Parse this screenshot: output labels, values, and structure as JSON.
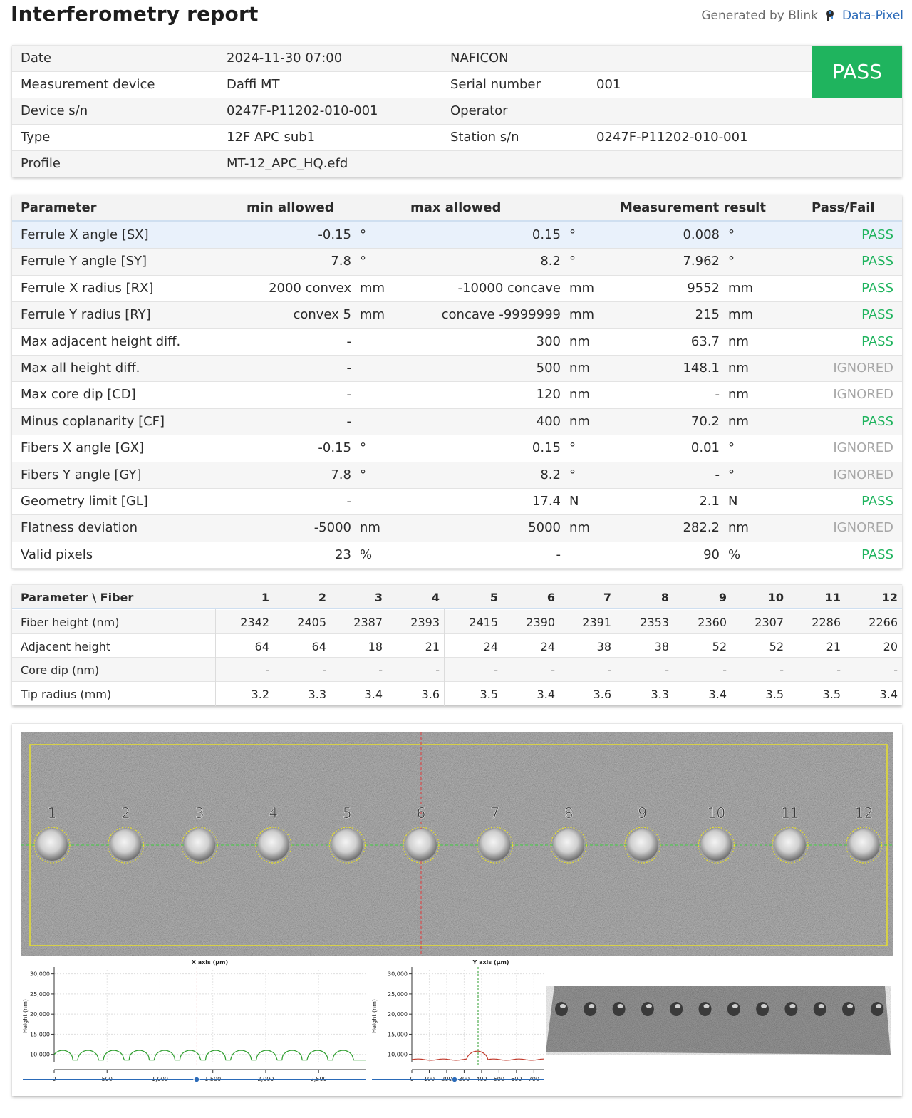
{
  "header": {
    "title": "Interferometry report",
    "generated_by": "Generated by Blink",
    "brand": "Data-Pixel"
  },
  "info": {
    "date_label": "Date",
    "date_value": "2024-11-30 07:00",
    "naficon_label": "NAFICON",
    "device_label": "Measurement device",
    "device_value": "Daffi MT",
    "serial_label": "Serial number",
    "serial_value": "001",
    "device_sn_label": "Device s/n",
    "device_sn_value": "0247F-P11202-010-001",
    "operator_label": "Operator",
    "type_label": "Type",
    "type_value": "12F APC sub1",
    "station_label": "Station s/n",
    "station_value": "0247F-P11202-010-001",
    "profile_label": "Profile",
    "profile_value": "MT-12_APC_HQ.efd",
    "result": "PASS",
    "result_color": "#1fb45e"
  },
  "params": {
    "headers": {
      "parameter": "Parameter",
      "min": "min allowed",
      "max": "max allowed",
      "result": "Measurement result",
      "passfail": "Pass/Fail"
    },
    "rows": [
      {
        "name": "Ferrule X angle [SX]",
        "min": "-0.15",
        "min_unit": "°",
        "max": "0.15",
        "max_unit": "°",
        "result": "0.008",
        "result_unit": "°",
        "status": "PASS"
      },
      {
        "name": "Ferrule Y angle [SY]",
        "min": "7.8",
        "min_unit": "°",
        "max": "8.2",
        "max_unit": "°",
        "result": "7.962",
        "result_unit": "°",
        "status": "PASS"
      },
      {
        "name": "Ferrule X radius [RX]",
        "min": "2000 convex",
        "min_unit": "mm",
        "max": "-10000 concave",
        "max_unit": "mm",
        "result": "9552",
        "result_unit": "mm",
        "status": "PASS"
      },
      {
        "name": "Ferrule Y radius [RY]",
        "min": "convex 5",
        "min_unit": "mm",
        "max": "concave -9999999",
        "max_unit": "mm",
        "result": "215",
        "result_unit": "mm",
        "status": "PASS"
      },
      {
        "name": "Max adjacent height diff.",
        "min": "-",
        "min_unit": "",
        "max": "300",
        "max_unit": "nm",
        "result": "63.7",
        "result_unit": "nm",
        "status": "PASS"
      },
      {
        "name": "Max all height diff.",
        "min": "-",
        "min_unit": "",
        "max": "500",
        "max_unit": "nm",
        "result": "148.1",
        "result_unit": "nm",
        "status": "IGNORED"
      },
      {
        "name": "Max core dip [CD]",
        "min": "-",
        "min_unit": "",
        "max": "120",
        "max_unit": "nm",
        "result": "-",
        "result_unit": "nm",
        "status": "IGNORED"
      },
      {
        "name": "Minus coplanarity [CF]",
        "min": "-",
        "min_unit": "",
        "max": "400",
        "max_unit": "nm",
        "result": "70.2",
        "result_unit": "nm",
        "status": "PASS"
      },
      {
        "name": "Fibers X angle [GX]",
        "min": "-0.15",
        "min_unit": "°",
        "max": "0.15",
        "max_unit": "°",
        "result": "0.01",
        "result_unit": "°",
        "status": "IGNORED"
      },
      {
        "name": "Fibers Y angle [GY]",
        "min": "7.8",
        "min_unit": "°",
        "max": "8.2",
        "max_unit": "°",
        "result": "-",
        "result_unit": "°",
        "status": "IGNORED"
      },
      {
        "name": "Geometry limit [GL]",
        "min": "-",
        "min_unit": "",
        "max": "17.4",
        "max_unit": "N",
        "result": "2.1",
        "result_unit": "N",
        "status": "PASS"
      },
      {
        "name": "Flatness deviation",
        "min": "-5000",
        "min_unit": "nm",
        "max": "5000",
        "max_unit": "nm",
        "result": "282.2",
        "result_unit": "nm",
        "status": "IGNORED"
      },
      {
        "name": "Valid pixels",
        "min": "23",
        "min_unit": "%",
        "max": "-",
        "max_unit": "",
        "result": "90",
        "result_unit": "%",
        "status": "PASS"
      }
    ],
    "status_colors": {
      "PASS": "#1fb45e",
      "IGNORED": "#a7a7a7"
    }
  },
  "fibers": {
    "header_label": "Parameter \\ Fiber",
    "columns": [
      "1",
      "2",
      "3",
      "4",
      "5",
      "6",
      "7",
      "8",
      "9",
      "10",
      "11",
      "12"
    ],
    "rows": [
      {
        "label": "Fiber height (nm)",
        "values": [
          "2342",
          "2405",
          "2387",
          "2393",
          "2415",
          "2390",
          "2391",
          "2353",
          "2360",
          "2307",
          "2286",
          "2266"
        ]
      },
      {
        "label": "Adjacent height",
        "values": [
          "64",
          "64",
          "18",
          "21",
          "24",
          "24",
          "38",
          "38",
          "52",
          "52",
          "21",
          "20"
        ]
      },
      {
        "label": "Core dip (nm)",
        "values": [
          "-",
          "-",
          "-",
          "-",
          "-",
          "-",
          "-",
          "-",
          "-",
          "-",
          "-",
          "-"
        ]
      },
      {
        "label": "Tip radius (mm)",
        "values": [
          "3.2",
          "3.3",
          "3.4",
          "3.6",
          "3.5",
          "3.4",
          "3.6",
          "3.3",
          "3.4",
          "3.5",
          "3.5",
          "3.4"
        ]
      }
    ]
  },
  "image": {
    "fiber_labels": [
      "1",
      "2",
      "3",
      "4",
      "5",
      "6",
      "7",
      "8",
      "9",
      "10",
      "11",
      "12"
    ]
  },
  "chart_data": [
    {
      "type": "line",
      "title": "X axis (µm)",
      "xlabel": "",
      "ylabel": "Height (nm)",
      "xlim": [
        0,
        2950
      ],
      "ylim": [
        8000,
        31000
      ],
      "x_ticks": [
        "0",
        "500",
        "1,000",
        "1,500",
        "2,000",
        "2,500"
      ],
      "y_ticks": [
        "10,000",
        "15,000",
        "20,000",
        "25,000",
        "30,000"
      ],
      "grid": true,
      "cursor_x": 1350,
      "series_color": "#2e9e2e",
      "cursor_color": "#d23b3b"
    },
    {
      "type": "line",
      "title": "Y axis (µm)",
      "xlabel": "",
      "ylabel": "Height (nm)",
      "xlim": [
        0,
        760
      ],
      "ylim": [
        8000,
        31000
      ],
      "x_ticks": [
        "0",
        "100",
        "200",
        "300",
        "400",
        "500",
        "600",
        "700"
      ],
      "y_ticks": [
        "10,000",
        "15,000",
        "20,000",
        "25,000",
        "30,000"
      ],
      "grid": true,
      "cursor_x": 380,
      "series_color": "#c0392b",
      "cursor_color": "#2e9e2e"
    }
  ]
}
